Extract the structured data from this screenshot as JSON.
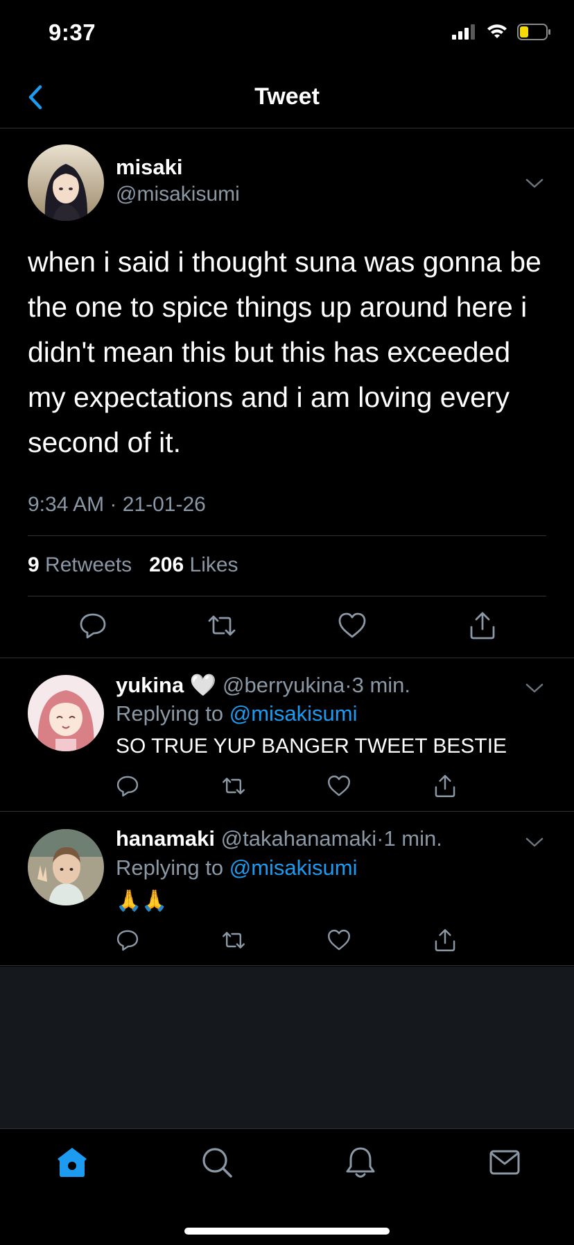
{
  "status_bar": {
    "time": "9:37"
  },
  "nav": {
    "title": "Tweet"
  },
  "main_tweet": {
    "name": "misaki",
    "handle": "@misakisumi",
    "text": "when i said i thought suna was gonna be the one to spice things up around here i didn't mean this but this has exceeded my expectations and i am loving every second of it.",
    "timestamp": "9:34 AM · 21-01-26",
    "retweet_count": "9",
    "retweet_label": "Retweets",
    "like_count": "206",
    "like_label": "Likes"
  },
  "replies": [
    {
      "name": "yukina 🤍",
      "handle": "@berryukina",
      "time": "3 min.",
      "replying_prefix": "Replying to",
      "replying_to": "@misakisumi",
      "text": "SO TRUE YUP BANGER TWEET BESTIE"
    },
    {
      "name": "hanamaki",
      "handle": "@takahanamaki",
      "time": "1 min.",
      "replying_prefix": "Replying to",
      "replying_to": "@misakisumi",
      "text": "🙏🙏"
    }
  ],
  "colors": {
    "background": "#000000",
    "accent": "#1d9bf0",
    "secondary_text": "#8b98a5",
    "divider": "#2f3336"
  },
  "icons": {
    "tabs": [
      "home-icon",
      "search-icon",
      "notifications-icon",
      "messages-icon"
    ],
    "actions": [
      "reply-icon",
      "retweet-icon",
      "like-icon",
      "share-icon"
    ]
  }
}
